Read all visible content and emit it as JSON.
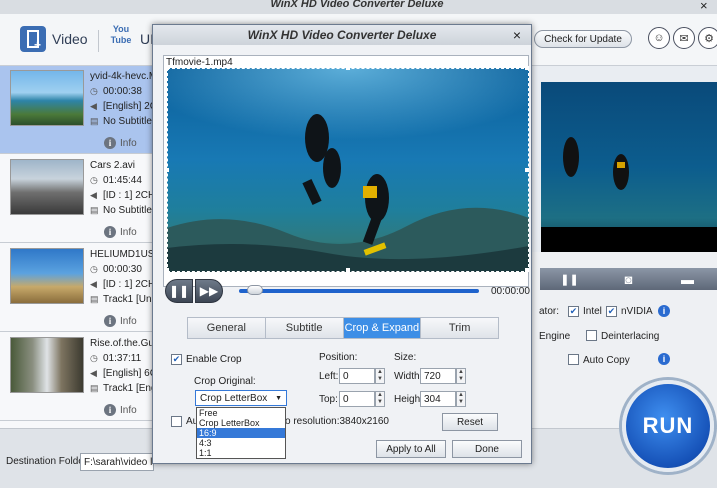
{
  "app": {
    "title": "WinX HD Video Converter Deluxe"
  },
  "toolbar": {
    "video_label": "Video",
    "youtube_label": "UI",
    "youtube_icon_text": "You Tube",
    "check_update": "Check for Update"
  },
  "files": [
    {
      "name": "yvid-4k-hevc.MP",
      "duration": "00:00:38",
      "audio": "[English] 2C",
      "subtitle": "No Subtitle",
      "info": "Info"
    },
    {
      "name": "Cars 2.avi",
      "duration": "01:45:44",
      "audio": "[ID : 1] 2CH",
      "subtitle": "No Subtitle",
      "info": "Info"
    },
    {
      "name": "HELIUMD1USA.m",
      "duration": "00:00:30",
      "audio": "[ID : 1] 2CH",
      "subtitle": "Track1 [Unk",
      "info": "Info"
    },
    {
      "name": "Rise.of.the.Gua",
      "duration": "01:37:11",
      "audio": "[English] 6C",
      "subtitle": "Track1 [Eng",
      "info": "Info"
    }
  ],
  "dialog": {
    "title": "WinX HD Video Converter Deluxe",
    "close": "×",
    "filename": "Tfmovie-1.mp4",
    "time": "00:00:00",
    "tabs": [
      "General",
      "Subtitle",
      "Crop & Expand",
      "Trim"
    ],
    "enable_crop": "Enable Crop",
    "crop_original": "Crop Original:",
    "crop_selected": "Crop LetterBox",
    "crop_options": [
      "Free",
      "Crop LetterBox",
      "16:9",
      "4:3",
      "1:1"
    ],
    "auto_prefix": "Au",
    "resolution_text": "o resolution:3840x2160",
    "position_label": "Position:",
    "left_label": "Left:",
    "left_value": "0",
    "top_label": "Top:",
    "top_value": "0",
    "size_label": "Size:",
    "width_label": "Width:",
    "width_value": "720",
    "height_label": "Height:",
    "height_value": "304",
    "reset": "Reset",
    "apply_all": "Apply to All",
    "done": "Done"
  },
  "right_panel": {
    "accelerator_label": "ator:",
    "intel": "Intel",
    "nvidia": "nVIDIA",
    "engine": "Engine",
    "deinterlacing": "Deinterlacing",
    "auto_copy": "Auto Copy",
    "run": "RUN"
  },
  "bottom": {
    "dest_label": "Destination Folder:",
    "dest_value": "F:\\sarah\\video librar"
  },
  "colors": {
    "accent": "#3d8ee6",
    "run": "#1f62c9"
  }
}
